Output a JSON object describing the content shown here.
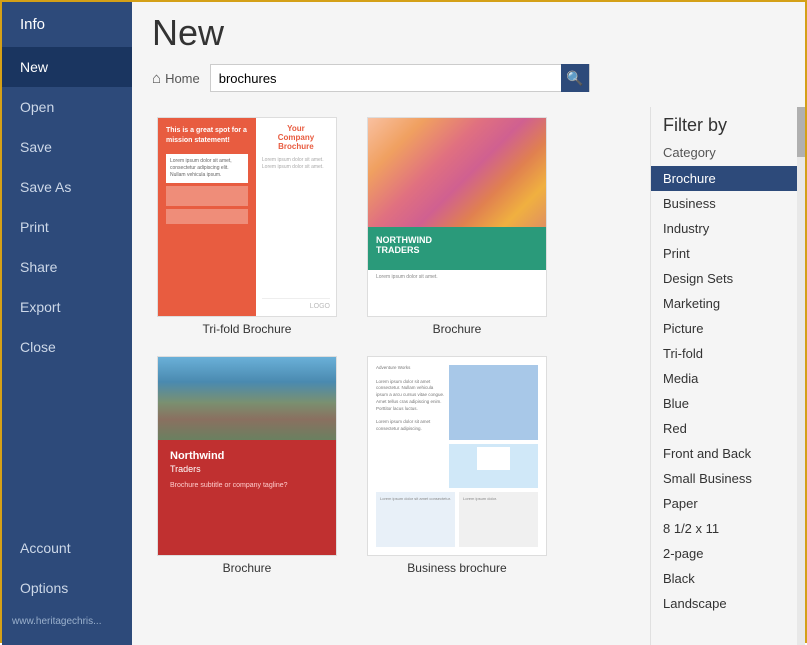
{
  "sidebar": {
    "items": [
      {
        "id": "info",
        "label": "Info",
        "active": false
      },
      {
        "id": "new",
        "label": "New",
        "active": true
      },
      {
        "id": "open",
        "label": "Open",
        "active": false
      },
      {
        "id": "save",
        "label": "Save",
        "active": false
      },
      {
        "id": "save-as",
        "label": "Save As",
        "active": false
      },
      {
        "id": "print",
        "label": "Print",
        "active": false
      },
      {
        "id": "share",
        "label": "Share",
        "active": false
      },
      {
        "id": "export",
        "label": "Export",
        "active": false
      },
      {
        "id": "close",
        "label": "Close",
        "active": false
      }
    ],
    "bottom_items": [
      {
        "id": "account",
        "label": "Account"
      },
      {
        "id": "options",
        "label": "Options"
      }
    ],
    "url": "www.heritagechris..."
  },
  "header": {
    "title": "New",
    "home_label": "Home",
    "search_placeholder": "brochures",
    "search_value": "brochures"
  },
  "templates": [
    {
      "id": "trifold",
      "label": "Tri-fold Brochure"
    },
    {
      "id": "brochure2",
      "label": "Brochure"
    },
    {
      "id": "brochure3",
      "label": "Brochure"
    },
    {
      "id": "business",
      "label": "Business brochure"
    }
  ],
  "filter": {
    "title": "Filter by",
    "category_label": "Category",
    "items": [
      {
        "label": "Brochure",
        "active": true
      },
      {
        "label": "Business",
        "active": false
      },
      {
        "label": "Industry",
        "active": false
      },
      {
        "label": "Print",
        "active": false
      },
      {
        "label": "Design Sets",
        "active": false
      },
      {
        "label": "Marketing",
        "active": false
      },
      {
        "label": "Picture",
        "active": false
      },
      {
        "label": "Tri-fold",
        "active": false
      },
      {
        "label": "Media",
        "active": false
      },
      {
        "label": "Blue",
        "active": false
      },
      {
        "label": "Red",
        "active": false
      },
      {
        "label": "Front and Back",
        "active": false
      },
      {
        "label": "Small Business",
        "active": false
      },
      {
        "label": "Paper",
        "active": false
      },
      {
        "label": "8 1/2 x 11",
        "active": false
      },
      {
        "label": "2-page",
        "active": false
      },
      {
        "label": "Black",
        "active": false
      },
      {
        "label": "Landscape",
        "active": false
      }
    ]
  }
}
